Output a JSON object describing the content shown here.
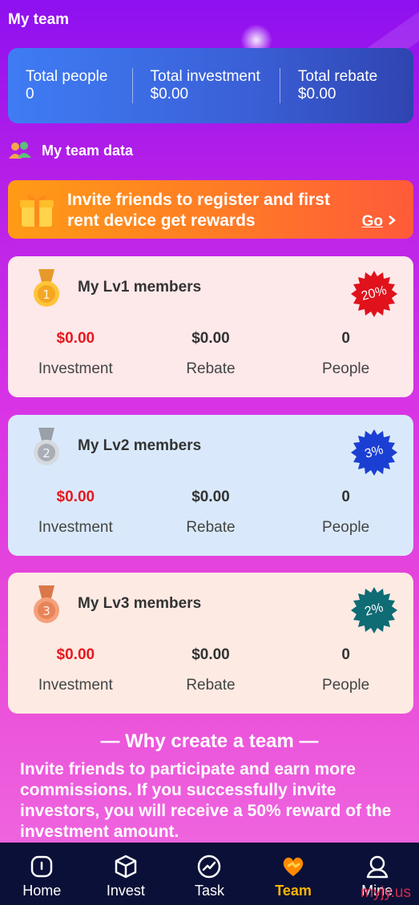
{
  "header": {
    "title": "My team"
  },
  "summary": [
    {
      "label": "Total people",
      "value": "0"
    },
    {
      "label": "Total investment",
      "value": "$0.00"
    },
    {
      "label": "Total rebate",
      "value": "$0.00"
    }
  ],
  "team_data": {
    "title": "My team data",
    "icon": "team-people-icon"
  },
  "invite": {
    "text": "Invite friends to register and first rent device get rewards",
    "go_label": "Go",
    "icon": "gift-icon"
  },
  "levels": [
    {
      "title": "My Lv1 members",
      "medal_number": "1",
      "rate": "20%",
      "card_color": "#fde8ea",
      "badge_color": "#e0121c",
      "investment": "$0.00",
      "rebate": "$0.00",
      "people": "0",
      "investment_label": "Investment",
      "rebate_label": "Rebate",
      "people_label": "People"
    },
    {
      "title": "My Lv2 members",
      "medal_number": "2",
      "rate": "3%",
      "card_color": "#d9e9fb",
      "badge_color": "#1b3fd3",
      "investment": "$0.00",
      "rebate": "$0.00",
      "people": "0",
      "investment_label": "Investment",
      "rebate_label": "Rebate",
      "people_label": "People"
    },
    {
      "title": "My Lv3 members",
      "medal_number": "3",
      "rate": "2%",
      "card_color": "#fdeae3",
      "badge_color": "#0f6b74",
      "investment": "$0.00",
      "rebate": "$0.00",
      "people": "0",
      "investment_label": "Investment",
      "rebate_label": "Rebate",
      "people_label": "People"
    }
  ],
  "why": {
    "title": "— Why create a team —",
    "text": "Invite friends to participate and earn more commissions. If you successfully invite investors, you will receive a 50% reward of the investment amount."
  },
  "tabbar": [
    {
      "label": "Home",
      "icon": "home-icon",
      "active": false
    },
    {
      "label": "Invest",
      "icon": "cube-icon",
      "active": false
    },
    {
      "label": "Task",
      "icon": "chart-circle-icon",
      "active": false
    },
    {
      "label": "Team",
      "icon": "heart-team-icon",
      "active": true
    },
    {
      "label": "Mine",
      "icon": "user-icon",
      "active": false
    }
  ],
  "watermark": "myjy.us",
  "colors": {
    "accent": "#ffb400",
    "tabbar_bg": "#0b1038",
    "value_red": "#e8171d"
  }
}
